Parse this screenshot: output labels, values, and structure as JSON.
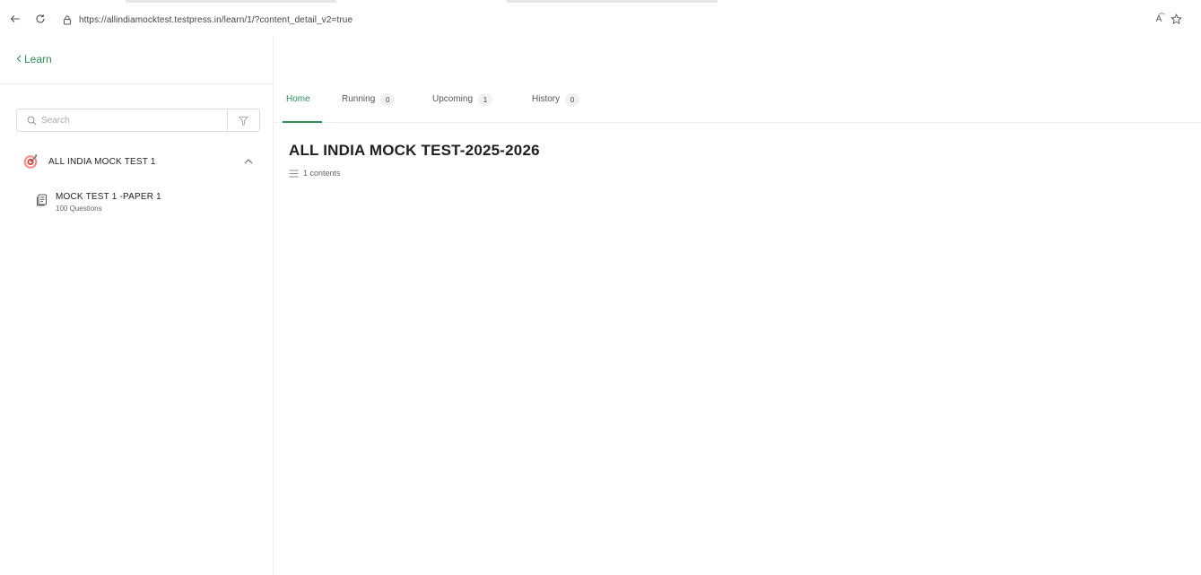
{
  "browser": {
    "url": "https://allindiamocktest.testpress.in/learn/1/?content_detail_v2=true",
    "read_aloud_label": "A͡"
  },
  "sidebar": {
    "back_label": "Learn",
    "search_placeholder": "Search",
    "section": {
      "title": "ALL INDIA MOCK TEST 1",
      "expanded": true,
      "items": [
        {
          "title": "MOCK TEST 1 -PAPER 1",
          "subtitle": "100 Questions"
        }
      ]
    }
  },
  "tabs": [
    {
      "label": "Home",
      "count": null,
      "active": true
    },
    {
      "label": "Running",
      "count": "0",
      "active": false
    },
    {
      "label": "Upcoming",
      "count": "1",
      "active": false
    },
    {
      "label": "History",
      "count": "0",
      "active": false
    }
  ],
  "main": {
    "title": "ALL INDIA MOCK TEST-2025-2026",
    "contents_label": "1 contents"
  },
  "colors": {
    "accent": "#2e8b57",
    "target_icon": "#e03b3b"
  }
}
